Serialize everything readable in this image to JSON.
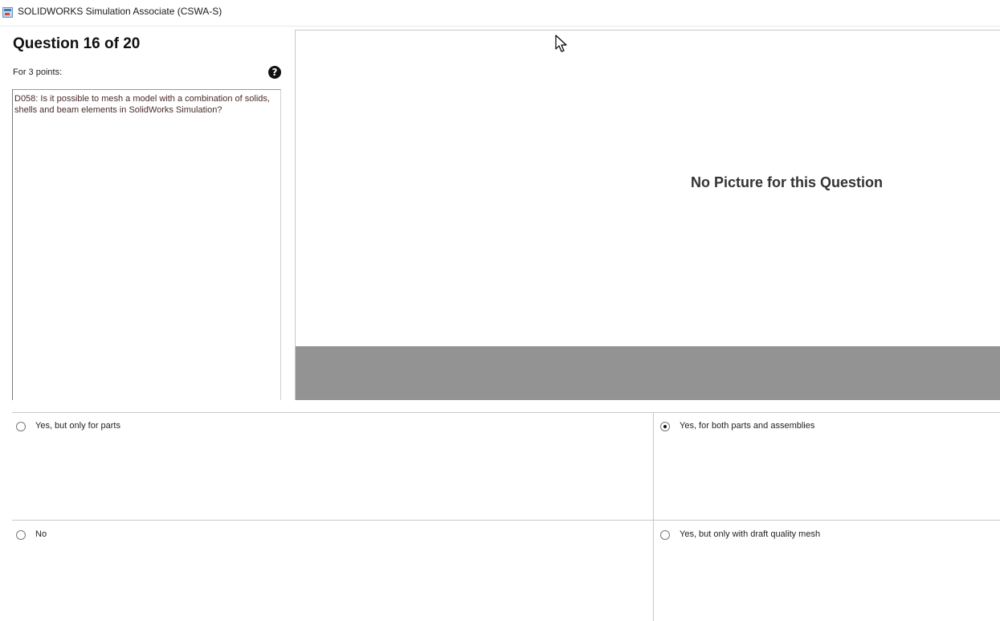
{
  "window": {
    "title": "SOLIDWORKS Simulation Associate (CSWA-S)",
    "icon": "app-window-icon"
  },
  "question": {
    "heading": "Question 16 of 20",
    "points": "For 3 points:",
    "help_icon": "question-circle-icon",
    "help_glyph": "?",
    "text": "D058: Is it possible to mesh a model with a combination of solids, shells and beam elements in SolidWorks Simulation?"
  },
  "picture": {
    "placeholder": "No Picture for this Question",
    "footer_color": "#939393"
  },
  "answers": [
    {
      "label": "Yes, but only for parts",
      "selected": false
    },
    {
      "label": "Yes, for both parts and assemblies",
      "selected": true
    },
    {
      "label": "No",
      "selected": false
    },
    {
      "label": "Yes, but only with draft quality mesh",
      "selected": false
    }
  ]
}
